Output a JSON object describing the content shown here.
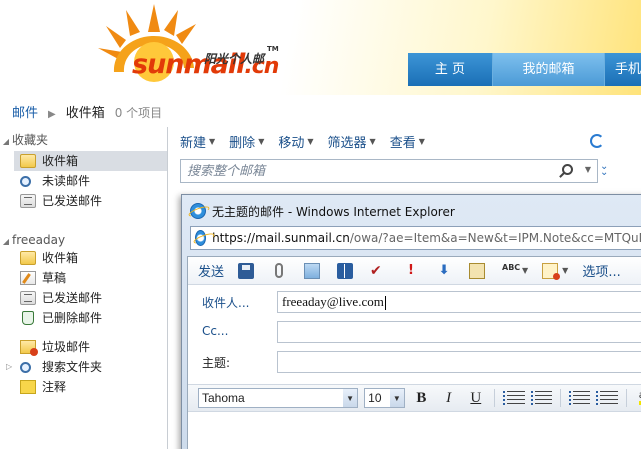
{
  "header": {
    "brand": "sunmail",
    "brand_tld": ".cn",
    "brand_cn": "阳光个人邮",
    "trademark": "TM",
    "nav": [
      {
        "label": "主 页"
      },
      {
        "label": "我的邮箱"
      },
      {
        "label": "手机"
      }
    ]
  },
  "breadcrumb": {
    "root": "邮件",
    "current": "收件箱",
    "count": "0 个项目"
  },
  "sidebar": {
    "favorites": {
      "label": "收藏夹",
      "items": [
        {
          "label": "收件箱",
          "icon": "inbox-folder-icon"
        },
        {
          "label": "未读邮件",
          "icon": "search-folder-icon"
        },
        {
          "label": "已发送邮件",
          "icon": "sent-folder-icon"
        }
      ]
    },
    "account": {
      "label": "freeaday",
      "items": [
        {
          "label": "收件箱",
          "icon": "inbox-folder-icon"
        },
        {
          "label": "草稿",
          "icon": "drafts-folder-icon"
        },
        {
          "label": "已发送邮件",
          "icon": "sent-folder-icon"
        },
        {
          "label": "已删除邮件",
          "icon": "deleted-folder-icon"
        },
        {
          "label": "垃圾邮件",
          "icon": "junk-folder-icon"
        },
        {
          "label": "搜索文件夹",
          "icon": "search-folder-icon"
        },
        {
          "label": "注释",
          "icon": "notes-folder-icon"
        }
      ]
    }
  },
  "toolbar": {
    "new": "新建",
    "delete": "删除",
    "move": "移动",
    "filter": "筛选器",
    "view": "查看"
  },
  "search": {
    "placeholder": "搜索整个邮箱"
  },
  "popup": {
    "title": "无主题的邮件 - Windows Internet Explorer",
    "url_scheme": "https://mail.",
    "url_host": "sunmail.cn",
    "url_rest": "/owa/?ae=Item&a=New&t=IPM.Note&cc=MTQuM",
    "compose": {
      "send": "发送",
      "options": "选项...",
      "to_label": "收件人...",
      "to_value": "freeaday@live.com",
      "cc_label": "Cc...",
      "subject_label": "主题:",
      "font": "Tahoma",
      "size": "10",
      "bold": "B",
      "italic": "I",
      "underline": "U",
      "spell_label": "ABC",
      "highlight_label": "ab"
    }
  },
  "colors": {
    "brand_orange": "#e23a08",
    "nav_blue": "#1a6fb6",
    "link_blue": "#1a4f8a"
  }
}
